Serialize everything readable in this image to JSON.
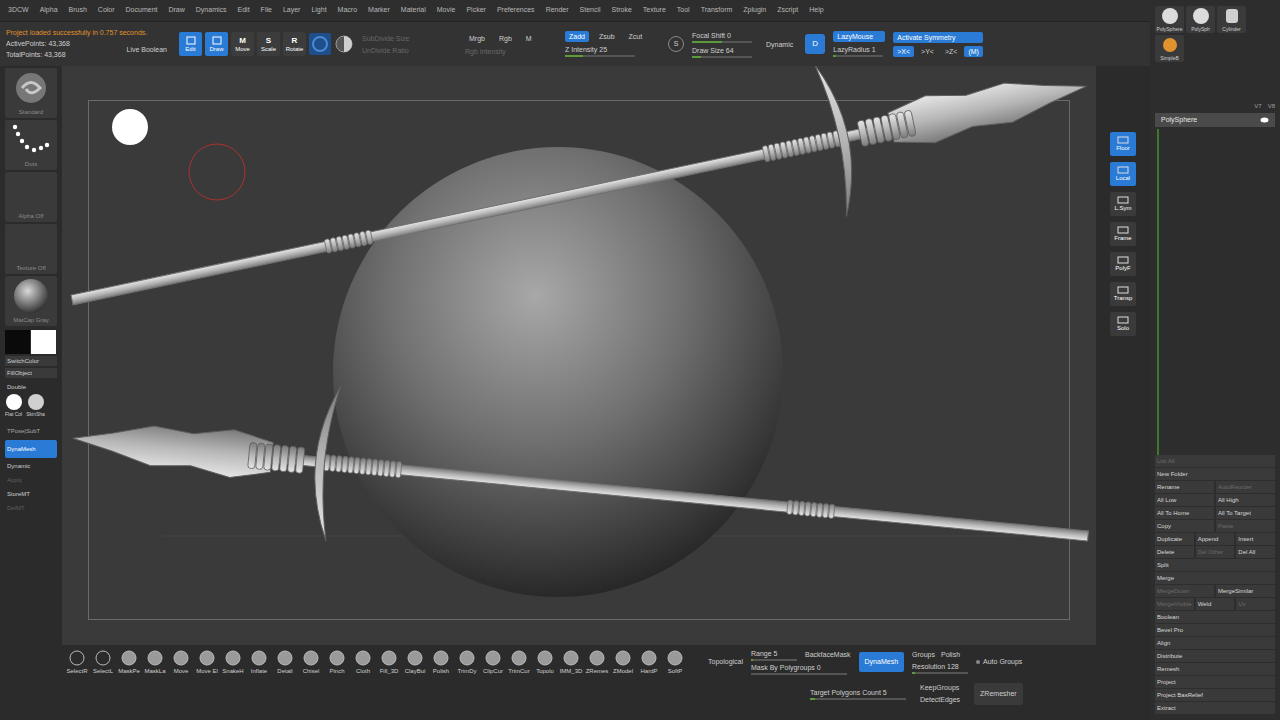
{
  "menu": [
    "3DCW",
    "Alpha",
    "Brush",
    "Color",
    "Document",
    "Draw",
    "Dynamics",
    "Edit",
    "File",
    "Layer",
    "Light",
    "Macro",
    "Marker",
    "Material",
    "Movie",
    "Picker",
    "Preferences",
    "Render",
    "Stencil",
    "Stroke",
    "Texture",
    "Tool",
    "Transform",
    "Zplugin",
    "Zscript",
    "Help"
  ],
  "status": {
    "message": "Project loaded successfully in 0.757 seconds.",
    "active_points": "ActivePoints: 43,368",
    "total_points": "TotalPoints: 43,368"
  },
  "toolbar": {
    "live_boolean": {
      "label": "Live Boolean",
      "selected": false
    },
    "modes": [
      {
        "label": "Edit",
        "key": "",
        "selected": true
      },
      {
        "label": "Draw",
        "key": "",
        "selected": true
      },
      {
        "label": "Move",
        "key": "M",
        "selected": false
      },
      {
        "label": "Scale",
        "key": "S",
        "selected": false
      },
      {
        "label": "Rotate",
        "key": "R",
        "selected": false
      }
    ],
    "subdivide": [
      {
        "label": "SubDivide Size",
        "disabled": true
      },
      {
        "label": "UnDivide Ratio",
        "disabled": true
      }
    ],
    "color_modes": [
      {
        "label": "Mrgb",
        "selected": false
      },
      {
        "label": "Rgb",
        "selected": false
      },
      {
        "label": "M",
        "selected": false
      }
    ],
    "rgb_intensity": {
      "label": "Rgb Intensity",
      "disabled": true
    },
    "z_modes": [
      {
        "label": "Zadd",
        "selected": true
      },
      {
        "label": "Zsub",
        "selected": false
      },
      {
        "label": "Zcut",
        "selected": false
      }
    ],
    "z_intensity": {
      "label": "Z Intensity 25",
      "level": 0.25
    },
    "s_key": "S",
    "d_key": "D",
    "focal_shift": {
      "label": "Focal Shift 0",
      "level": 0.5
    },
    "draw_size": {
      "label": "Draw Size 64",
      "level": 0.15
    },
    "dynamic": {
      "label": "Dynamic",
      "selected": false
    },
    "lazy_mouse": {
      "label": "LazyMouse",
      "selected": true
    },
    "lazy_radius": {
      "label": "LazyRadius 1",
      "level": 0.05
    },
    "symmetry": {
      "label": "Activate Symmetry",
      "selected": true
    },
    "axes": [
      {
        "label": ">X<",
        "selected": true
      },
      {
        "label": ">Y<",
        "selected": false
      },
      {
        "label": ">Z<",
        "selected": false
      },
      {
        "label": "(M)",
        "selected": true
      }
    ]
  },
  "left_shelf": {
    "thumbnails": [
      {
        "label": "Standard",
        "kind": "brush"
      },
      {
        "label": "Dots",
        "kind": "stroke"
      },
      {
        "label": "Alpha Off",
        "kind": "empty"
      },
      {
        "label": "Texture Off",
        "kind": "empty"
      },
      {
        "label": "MatCap Gray",
        "kind": "material"
      }
    ],
    "swatches": [
      {
        "color": "#0a0a0a"
      },
      {
        "color": "#ffffff"
      }
    ],
    "switch_color": "SwitchColor",
    "fill_object": "FillObject",
    "double": "Double",
    "shaders": [
      {
        "label": "Flat Col",
        "color": "#ffffff"
      },
      {
        "label": "SkinSha",
        "color": "#d0d0d0"
      }
    ],
    "tpose": "TPose|SubT",
    "dynamesh": {
      "label": "DynaMesh",
      "selected": true
    },
    "buttons": [
      {
        "label": "Dynamic",
        "disabled": false
      },
      {
        "label": "Apply",
        "disabled": true
      },
      {
        "label": "StoreMT",
        "disabled": false
      },
      {
        "label": "DelMT",
        "disabled": true
      }
    ]
  },
  "right_shelf": [
    {
      "label": "Floor",
      "selected": true
    },
    {
      "label": "Local",
      "selected": true
    },
    {
      "label": "L.Sym",
      "selected": false
    },
    {
      "label": "Frame",
      "selected": false
    },
    {
      "label": "PolyF",
      "selected": false
    },
    {
      "label": "Transp",
      "selected": false
    },
    {
      "label": "Solo",
      "selected": false
    }
  ],
  "tool_panel": {
    "thumbnails": [
      {
        "label": "PolySphere",
        "kind": "sphere"
      },
      {
        "label": "PolySph",
        "kind": "sphere"
      },
      {
        "label": "Cylinder",
        "kind": "cylinder"
      },
      {
        "label": "SimpleB",
        "kind": "brush"
      }
    ],
    "versions": [
      "V7",
      "V8"
    ],
    "subtools": [
      {
        "label": "PolySphere",
        "selected": true
      }
    ],
    "rows": [
      [
        {
          "label": "List All",
          "disabled": true
        }
      ],
      [
        {
          "label": "New Folder",
          "disabled": false
        }
      ],
      [
        {
          "label": "Rename",
          "disabled": false
        },
        {
          "label": "AutoReorder",
          "disabled": true
        }
      ],
      [
        {
          "label": "All Low",
          "disabled": false
        },
        {
          "label": "All High",
          "disabled": false
        }
      ],
      [
        {
          "label": "All To Home",
          "disabled": false
        },
        {
          "label": "All To Target",
          "disabled": false
        }
      ],
      [
        {
          "label": "Copy",
          "disabled": false
        },
        {
          "label": "Paste",
          "disabled": true
        }
      ],
      [
        {
          "label": "Duplicate",
          "disabled": false
        },
        {
          "label": "Append",
          "disabled": false
        },
        {
          "label": "Insert",
          "disabled": false
        }
      ],
      [
        {
          "label": "Delete",
          "disabled": false
        },
        {
          "label": "Del Other",
          "disabled": true
        },
        {
          "label": "Del All",
          "disabled": false
        }
      ],
      [
        {
          "label": "Split",
          "disabled": false
        }
      ],
      [
        {
          "label": "Merge",
          "disabled": false
        }
      ],
      [
        {
          "label": "MergeDown",
          "disabled": true
        },
        {
          "label": "MergeSimilar",
          "disabled": false
        }
      ],
      [
        {
          "label": "MergeVisible",
          "disabled": true
        },
        {
          "label": "Weld",
          "disabled": false
        },
        {
          "label": "Uv",
          "disabled": true
        }
      ],
      [
        {
          "label": "Boolean",
          "disabled": false
        }
      ],
      [
        {
          "label": "Bevel Pro",
          "disabled": false
        }
      ],
      [
        {
          "label": "Align",
          "disabled": false
        }
      ],
      [
        {
          "label": "Distribute",
          "disabled": false
        }
      ],
      [
        {
          "label": "Remesh",
          "disabled": false
        }
      ],
      [
        {
          "label": "Project",
          "disabled": false
        }
      ],
      [
        {
          "label": "Project BasRelief",
          "disabled": false
        }
      ],
      [
        {
          "label": "Extract",
          "disabled": false
        }
      ]
    ]
  },
  "bottom": {
    "brushes": [
      "SelectR",
      "SelectL",
      "MaskPe",
      "MaskLa",
      "Move",
      "Move El",
      "SnakeH",
      "Inflate",
      "Detail",
      "Chisel",
      "Pinch",
      "Cloth",
      "Fill_3D",
      "ClayBui",
      "Polish",
      "TrimDy",
      "ClipCur",
      "TrimCur",
      "Topolo",
      "IMM_3D",
      "ZRemes",
      "ZModel",
      "HardP",
      "SoftP"
    ],
    "remesh": {
      "topological": "Topological",
      "range": {
        "label": "Range 5",
        "level": 0.05
      },
      "backface_mask": "BackfaceMask",
      "mask_by_polygroups": {
        "label": "Mask By Polygroups 0",
        "level": 0
      },
      "dynamesh": {
        "label": "DynaMesh",
        "selected": true
      },
      "groups": "Groups",
      "polish": "Polish",
      "resolution": {
        "label": "Resolution 128",
        "level": 0.06
      },
      "auto_groups": {
        "label": "Auto Groups",
        "on": false
      },
      "target_polygons": {
        "label": "Target Polygons Count 5",
        "level": 0.05
      },
      "keep_groups": "KeepGroups",
      "detect_edges": "DetectEdges",
      "zremesher": "ZRemesher"
    }
  }
}
